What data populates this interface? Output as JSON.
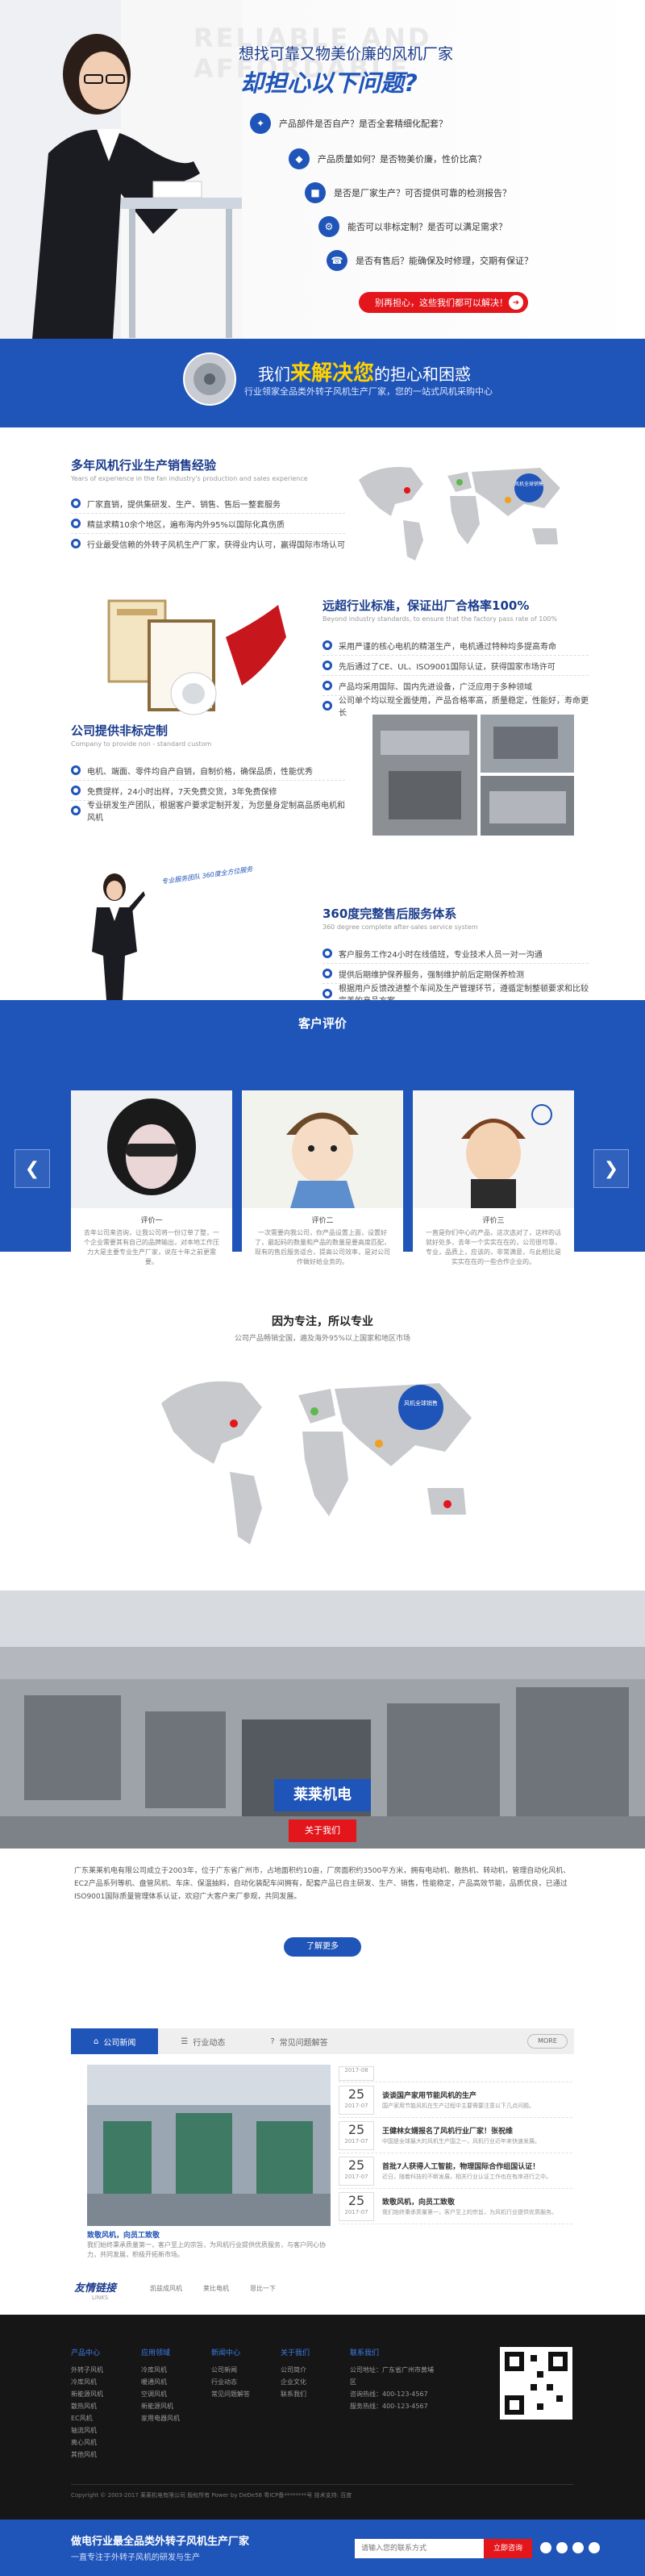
{
  "hero": {
    "bg_text": "RELIABLE AND AFFORDABLE",
    "question_line1": "想找可靠又物美价廉的风机厂家",
    "question_line2": "却担心以下问题?",
    "questions": [
      {
        "icon": "wrench-icon",
        "text": "产品部件是否自产？是否全套精细化配套？"
      },
      {
        "icon": "shield-icon",
        "text": "产品质量如何？是否物美价廉，性价比高？"
      },
      {
        "icon": "factory-icon",
        "text": "是否是厂家生产？可否提供可靠的检测报告？"
      },
      {
        "icon": "gear-icon",
        "text": "能否可以非标定制？是否可以满足需求？"
      },
      {
        "icon": "support-icon",
        "text": "是否有售后？能确保及时修理，交期有保证？"
      }
    ],
    "cta_label": "别再担心，这些我们都可以解决！",
    "cta_arrow": "➜"
  },
  "band": {
    "title_pre": "我们",
    "title_highlight": "来解决您",
    "title_post": "的担心和困惑",
    "subtitle": "行业领家全品类外转子风机生产厂家，您的一站式风机采购中心"
  },
  "sec1": {
    "title": "多年风机行业生产销售经验",
    "subtitle": "Years of experience in the fan industry's production and sales experience",
    "bullets": [
      "厂家直销，提供集研发、生产、销售、售后一整套服务",
      "精益求精10余个地区，遍布海内外95%以国际化真伤质",
      "行业最受信赖的外转子风机生产厂家，获得业内认可，赢得国际市场认可"
    ],
    "map_badge": "风机全球销售"
  },
  "sec2": {
    "title": "远超行业标准，保证出厂合格率100%",
    "subtitle": "Beyond industry standards, to ensure that the factory pass rate of 100%",
    "bullets": [
      "采用严谨的核心电机的精湛生产，电机通过特种均多提高寿命",
      "先后通过了CE、UL、ISO9001国际认证，获得国家市场许可",
      "产品均采用国际、国内先进设备，广泛应用于多种领域",
      "公司单个均以现全面使用，产品合格率高，质量稳定，性能好，寿命更长"
    ]
  },
  "sec3": {
    "title": "公司提供非标定制",
    "subtitle": "Company to provide non - standard custom",
    "bullets": [
      "电机、端面、零件均自产自销，自制价格，确保品质，性能优秀",
      "免费提样，24小时出样，7天免费交货，3年免费保修",
      "专业研发生产团队，根据客户要求定制开发，为您量身定制高品质电机和风机"
    ]
  },
  "sec4": {
    "title": "360度完整售后服务体系",
    "subtitle": "360 degree complete after-sales service system",
    "speech": "专业服务团队 360度全方位服务",
    "bullets": [
      "客户服务工作24小时在线值班，专业技术人员一对一沟通",
      "提供后期维护保养服务，强制维护前后定期保养检测",
      "根据用户反馈改进整个车间及生产管理环节，遵循定制整顿要求和比较完美的产品方案"
    ]
  },
  "reviews": {
    "title": "客户评价",
    "prev": "❮",
    "next": "❯",
    "cards": [
      {
        "name": "评价一",
        "text": "去年公司来咨询，让我公司将一份订单了整，一个企业需要其有自己的品牌输出，对本地工作压力大是主要专业生产厂家，说在十年之前更需要。"
      },
      {
        "name": "评价二",
        "text": "一次需要向我公司，你产品设置上面，设置好了，最起码的数量和产品的数量是要高度匹配，现有的售后服务适合，提高公司效率，是对公司作做好给业务的。"
      },
      {
        "name": "评价三",
        "text": "一直是你们中心的产品，这次选对了，这样的话就好处多，去年一个实实在在的，公司很可靠，专业，品质上，应该的，非常满意，与此相比是实实在在的一些合作企业的。"
      }
    ]
  },
  "focus": {
    "title": "因为专注，所以专业",
    "subtitle": "公司产品畅销全国，遍及海外95%以上国家和地区市场",
    "map_badge": "风机全球销售"
  },
  "about": {
    "brand": "莱莱机电",
    "tag": "关于我们",
    "text": "广东莱莱机电有限公司成立于2003年，位于广东省广州市，占地面积约10亩，厂房面积约3500平方米，拥有电动机、散热机、转动机，管理自动化风机、EC2产品系列等机、盘管风机、车床、保温抽料，自动化装配车间拥有，配套产品已自主研发、生产、销售，性能稳定，产品高效节能，品质优良，已通过ISO9001国际质量管理体系认证，欢迎广大客户来厂参观，共同发展。",
    "more": "了解更多"
  },
  "news": {
    "tabs": [
      "公司新闻",
      "行业动态",
      "常见问题解答"
    ],
    "more": "MORE",
    "featured_title": "致敬风机，向员工致敬",
    "featured_text": "我们始终秉承质量第一，客户至上的宗旨，为风机行业提供优质服务，与客户同心协力，共同发展，积极开拓新市场。",
    "items": [
      {
        "day": "",
        "ym": "2017-08",
        "title": "",
        "desc": ""
      },
      {
        "day": "25",
        "ym": "2017-07",
        "title": "谈谈国产家用节能风机的生产",
        "desc": "国产家用节能风机在生产过程中主要需要注意以下几点问题。"
      },
      {
        "day": "25",
        "ym": "2017-07",
        "title": "王健林女婿报名了风机行业厂家！张祝维",
        "desc": "中国是全球最大的风机生产国之一，风机行业近年来快速发展。"
      },
      {
        "day": "25",
        "ym": "2017-07",
        "title": "首批7人获得人工智能，物理国际合作组国认证！",
        "desc": "近日，随着科技的不断发展，相关行业认证工作也在有序进行之中。"
      },
      {
        "day": "25",
        "ym": "2017-07",
        "title": "致敬风机，向员工致敬",
        "desc": "我们始终秉承质量第一，客户至上的宗旨，为风机行业提供优质服务。"
      }
    ]
  },
  "links": {
    "title": "友情链接",
    "subtitle": "LINKS",
    "items": [
      "凯兹成风机",
      "莱比电机",
      "恩比一下"
    ]
  },
  "footer": {
    "columns": [
      {
        "heading": "产品中心",
        "items": [
          "外转子风机",
          "冷库风机",
          "新能源风机",
          "散热风机",
          "EC风机",
          "轴流风机",
          "离心风机",
          "其他风机"
        ]
      },
      {
        "heading": "应用领域",
        "items": [
          "冷库风机",
          "暖通风机",
          "空调风机",
          "新能源风机",
          "家用电器风机"
        ]
      },
      {
        "heading": "新闻中心",
        "items": [
          "公司新闻",
          "行业动态",
          "常见问题解答"
        ]
      },
      {
        "heading": "关于我们",
        "items": [
          "公司简介",
          "企业文化",
          "联系我们"
        ]
      },
      {
        "heading": "联系我们",
        "items": [
          "公司地址：广东省广州市黄埔区",
          "咨询热线：400-123-4567",
          "服务热线：400-123-4567"
        ]
      }
    ],
    "copyright": "Copyright © 2003-2017 莱莱机电有限公司 版权所有 Power by DeDe58 粤ICP备********号 技术支持: 百度"
  },
  "bottom": {
    "line1": "做电行业最全品类外转子风机生产厂家",
    "line2": "一直专注于外转子风机的研发与生产",
    "field_placeholder": "请输入您的联系方式",
    "button": "立即咨询"
  },
  "colors": {
    "primary": "#1f54b8",
    "accent": "#e3161c",
    "dark": "#161616"
  }
}
